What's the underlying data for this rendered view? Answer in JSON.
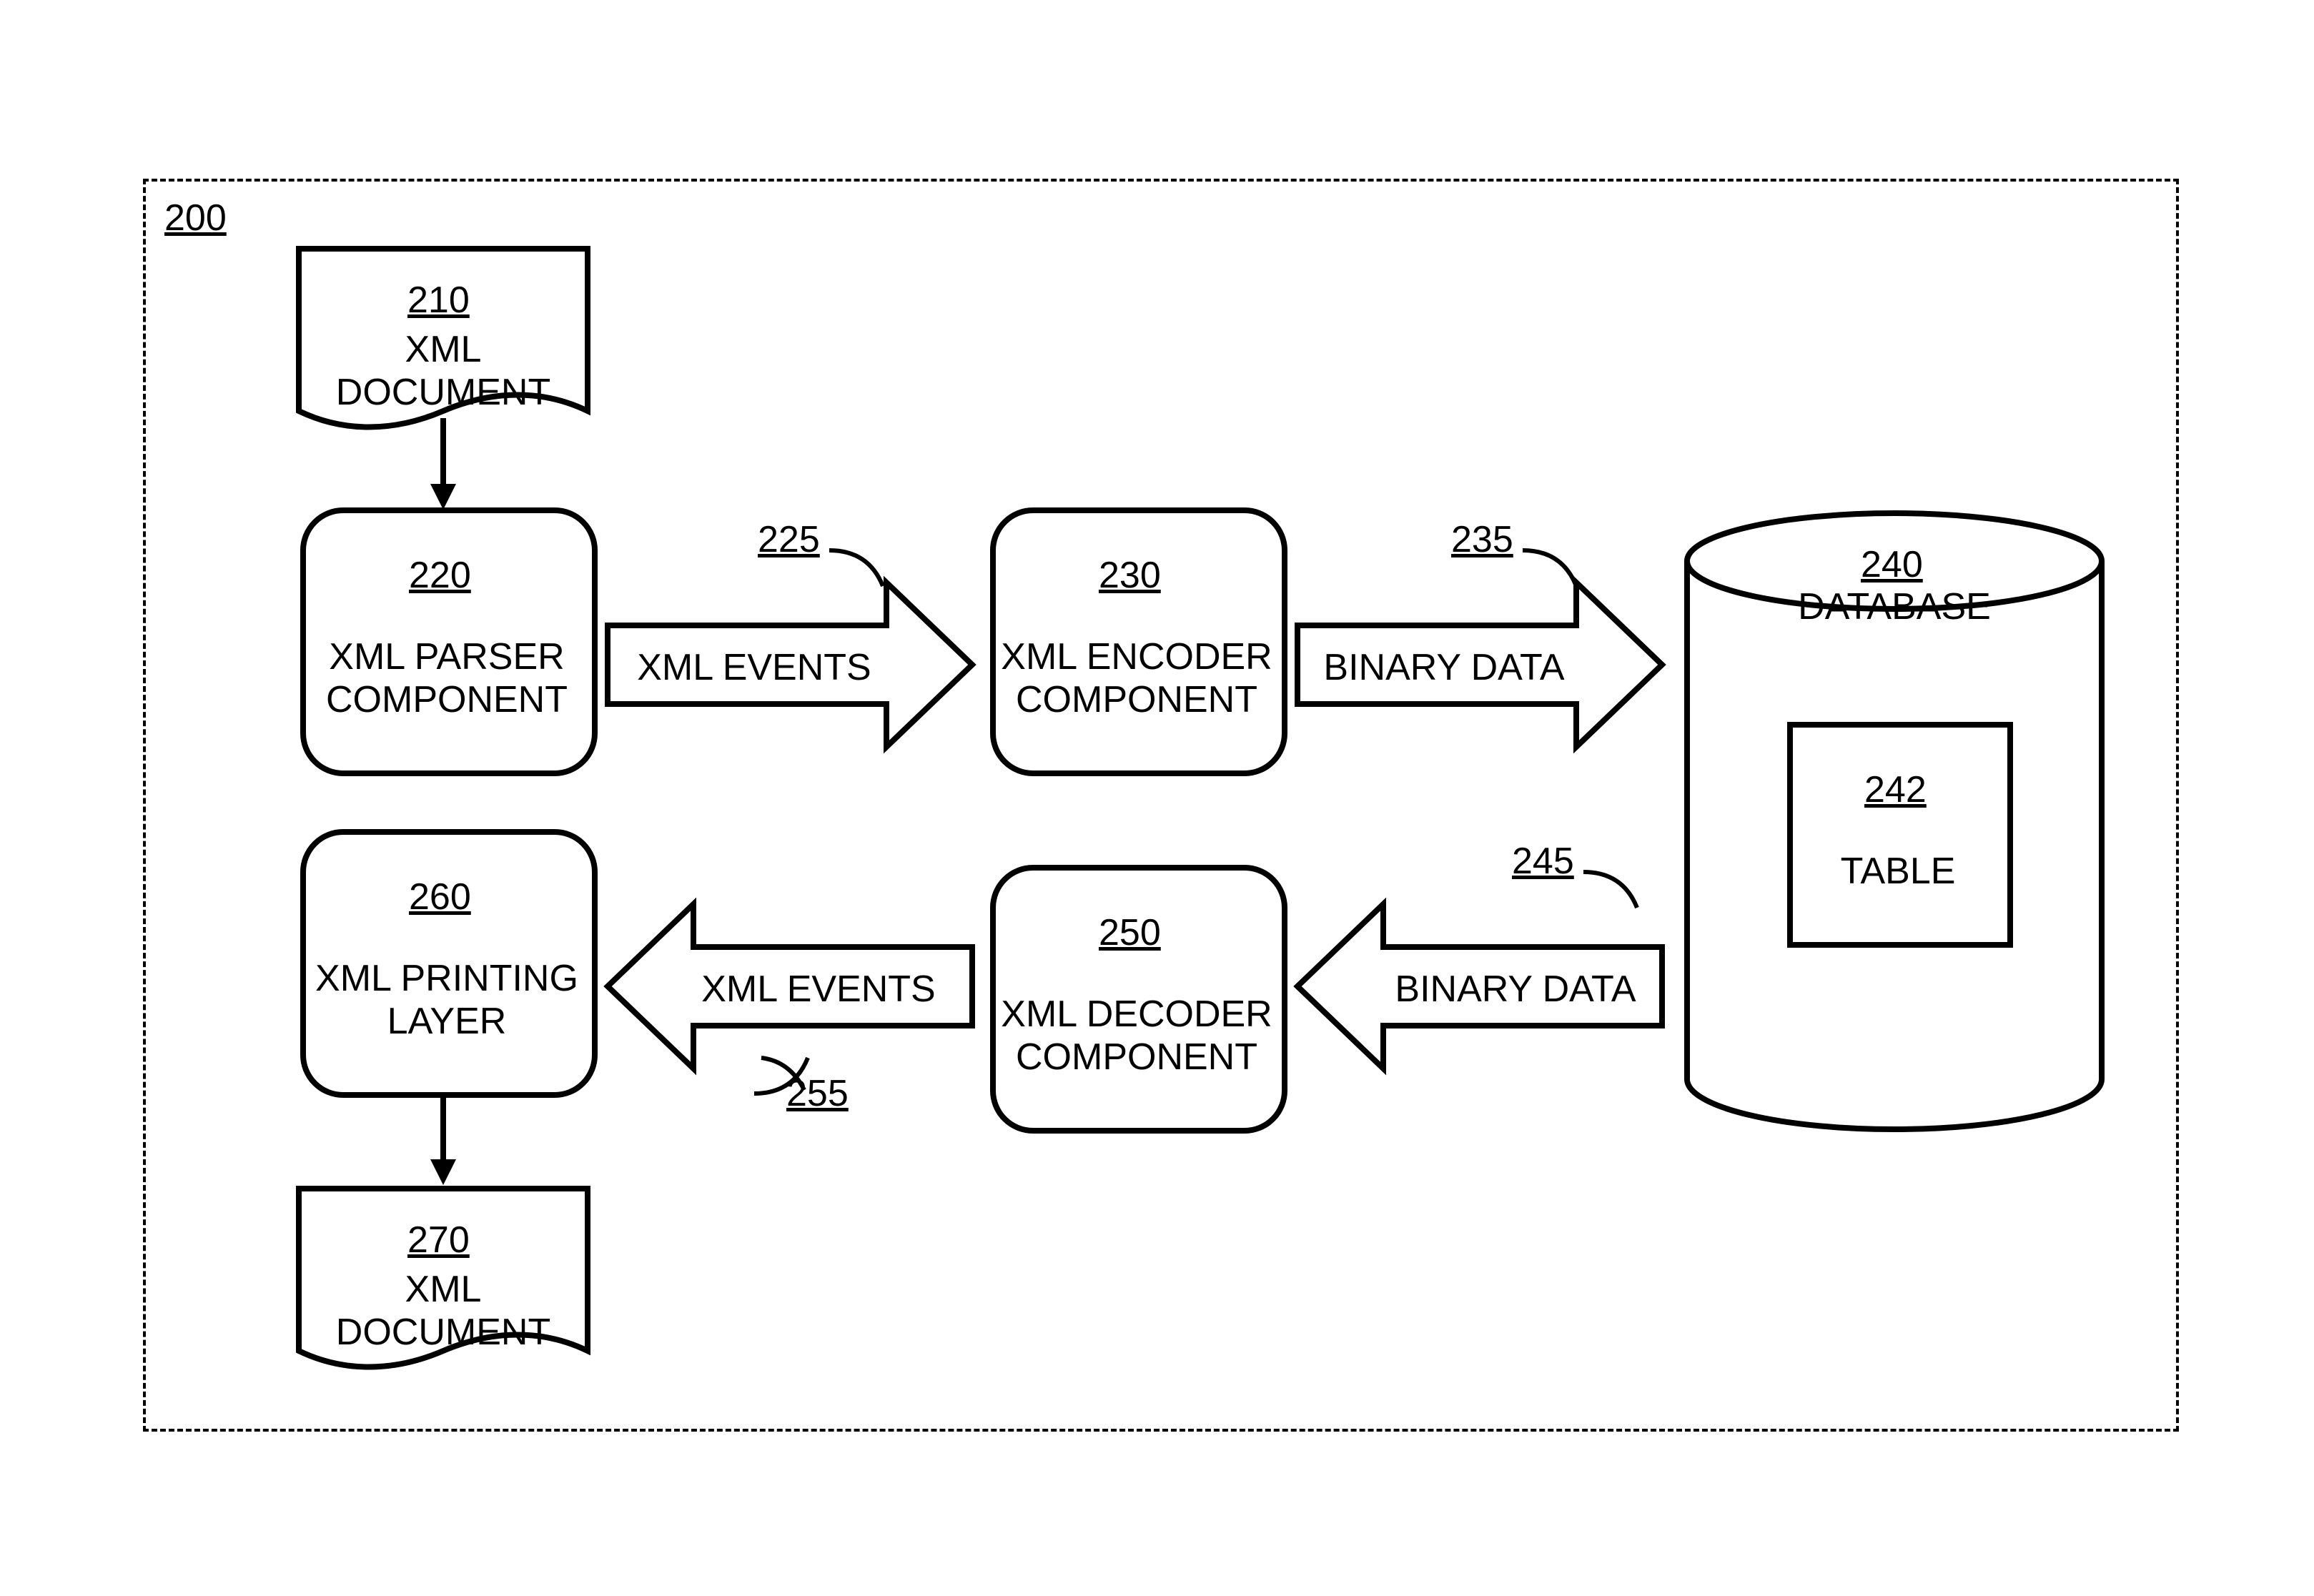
{
  "container": {
    "ref": "200"
  },
  "nodes": {
    "doc_in": {
      "ref": "210",
      "label": "XML DOCUMENT"
    },
    "parser": {
      "ref": "220",
      "label": "XML PARSER\nCOMPONENT"
    },
    "encoder": {
      "ref": "230",
      "label": "XML ENCODER\nCOMPONENT"
    },
    "database": {
      "ref": "240",
      "label": "DATABASE"
    },
    "table": {
      "ref": "242",
      "label": "TABLE"
    },
    "decoder": {
      "ref": "250",
      "label": "XML DECODER\nCOMPONENT"
    },
    "printer": {
      "ref": "260",
      "label": "XML PRINTING\nLAYER"
    },
    "doc_out": {
      "ref": "270",
      "label": "XML DOCUMENT"
    }
  },
  "arrows": {
    "events_fwd": {
      "ref": "225",
      "label": "XML EVENTS"
    },
    "binary_fwd": {
      "ref": "235",
      "label": "BINARY DATA"
    },
    "binary_back": {
      "ref": "245",
      "label": "BINARY DATA"
    },
    "events_back": {
      "ref": "255",
      "label": "XML EVENTS"
    }
  }
}
